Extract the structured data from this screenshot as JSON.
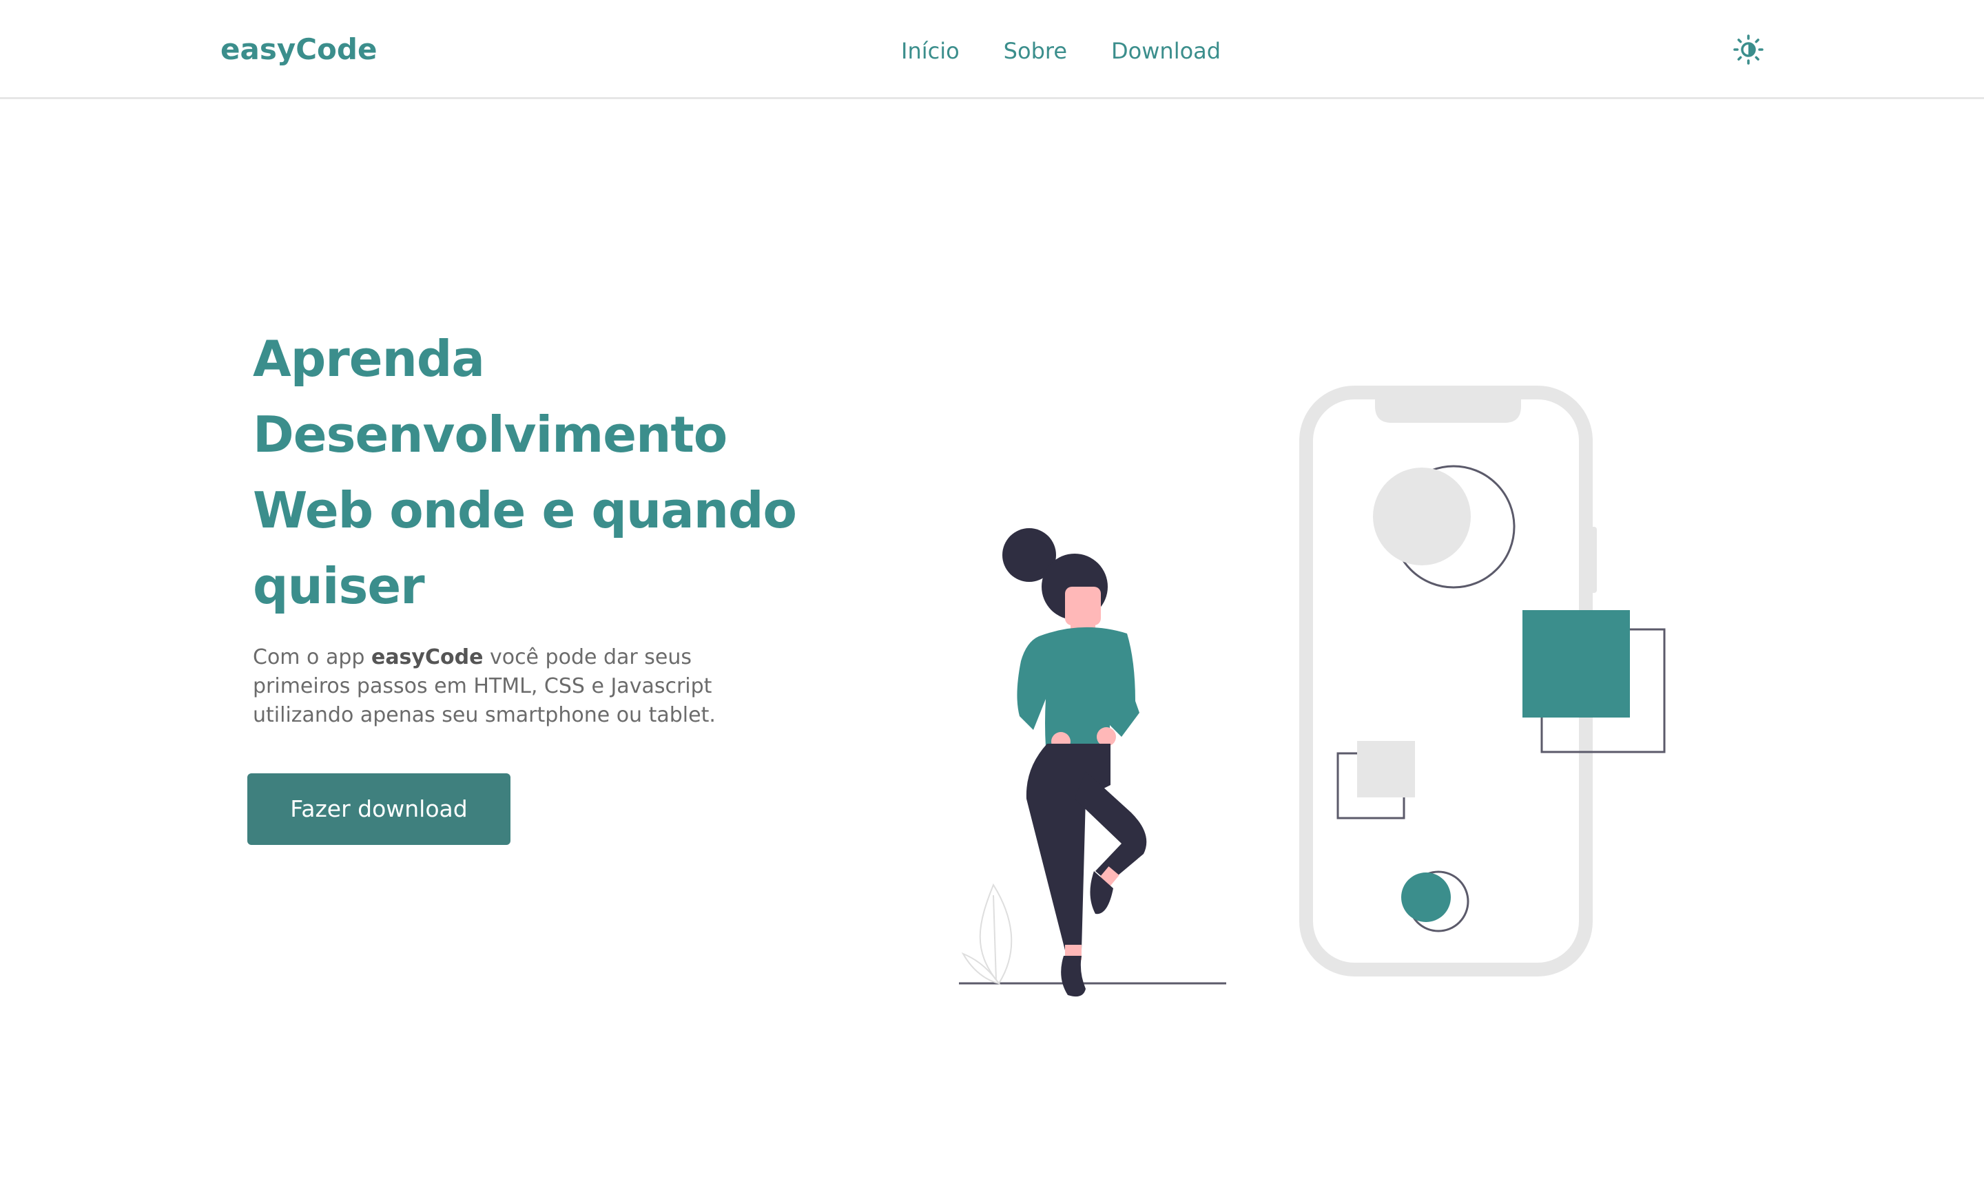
{
  "header": {
    "logo": "easyCode",
    "nav": [
      {
        "label": "Início"
      },
      {
        "label": "Sobre"
      },
      {
        "label": "Download"
      }
    ],
    "theme_toggle_icon": "sun-icon"
  },
  "hero": {
    "title": "Aprenda Desenvolvimento Web onde e quando quiser",
    "description": {
      "before": "Com o app ",
      "brand": "easyCode",
      "after": " você pode dar seus primeiros passos em HTML, CSS e Javascript utilizando apenas seu smartphone ou tablet."
    },
    "cta_label": "Fazer download"
  },
  "colors": {
    "brand": "#3b8e8c",
    "button": "#3f807e",
    "text_muted": "#6b6b6b",
    "figure_dark": "#2f2e41",
    "figure_skin": "#ffb8b8",
    "phone_outline": "#e6e6e6"
  }
}
